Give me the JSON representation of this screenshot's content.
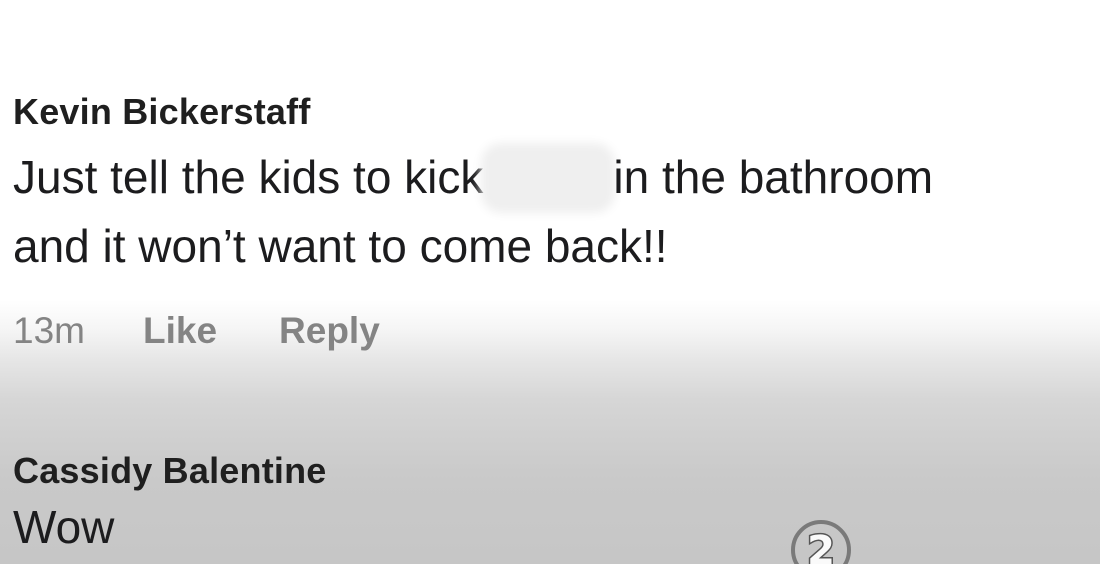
{
  "comments": [
    {
      "author": "Kevin Bickerstaff",
      "text_line1_start": "Just tell the kids to kick",
      "text_line1_end": "in the bathroom",
      "text_line2": "and it won’t want to come back!!",
      "time": "13m",
      "like_label": "Like",
      "reply_label": "Reply"
    },
    {
      "author": "Cassidy Balentine",
      "text": "Wow"
    }
  ],
  "watermark": {
    "label": "2",
    "icon": "channel-2-logo"
  },
  "colors": {
    "text": "#1c1c1e",
    "action_text": "#848484",
    "background_top": "#ffffff",
    "background_bottom": "#c6c6c6"
  }
}
